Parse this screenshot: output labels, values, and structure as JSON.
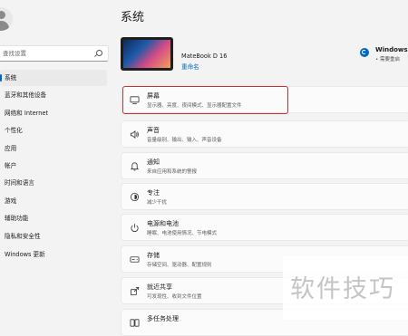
{
  "sidebar": {
    "search_placeholder": "查找设置",
    "items": [
      {
        "label": "系统",
        "selected": true
      },
      {
        "label": "蓝牙和其他设备"
      },
      {
        "label": "网络和 Internet"
      },
      {
        "label": "个性化"
      },
      {
        "label": "应用"
      },
      {
        "label": "帐户"
      },
      {
        "label": "时间和语言"
      },
      {
        "label": "游戏"
      },
      {
        "label": "辅助功能"
      },
      {
        "label": "隐私和安全性"
      },
      {
        "label": "Windows 更新"
      }
    ]
  },
  "main": {
    "title": "系统",
    "device": {
      "name": "MateBook D 16",
      "rename": "重命名"
    },
    "update": {
      "title": "Windows 更新",
      "status": "• 需要重启"
    },
    "cards": [
      {
        "title": "屏幕",
        "subtitle": "显示器、亮度、夜间模式、显示器配置文件",
        "icon": "monitor-icon"
      },
      {
        "title": "声音",
        "subtitle": "音量级别、输出、输入、声音设备",
        "icon": "speaker-icon"
      },
      {
        "title": "通知",
        "subtitle": "来自应用和系统的警报",
        "icon": "bell-icon"
      },
      {
        "title": "专注",
        "subtitle": "减少干扰",
        "icon": "focus-icon"
      },
      {
        "title": "电源和电池",
        "subtitle": "睡眠、电池使用情况、节电模式",
        "icon": "power-icon"
      },
      {
        "title": "存储",
        "subtitle": "存储空间、驱动器、配置规则",
        "icon": "storage-icon"
      },
      {
        "title": "就近共享",
        "subtitle": "可发现性、收到文件位置",
        "icon": "share-icon"
      },
      {
        "title": "多任务处理",
        "subtitle": "",
        "icon": "multitask-icon"
      }
    ]
  },
  "watermark": "软件技巧",
  "colors": {
    "accent": "#0067c0",
    "highlight": "#d42c2c"
  }
}
